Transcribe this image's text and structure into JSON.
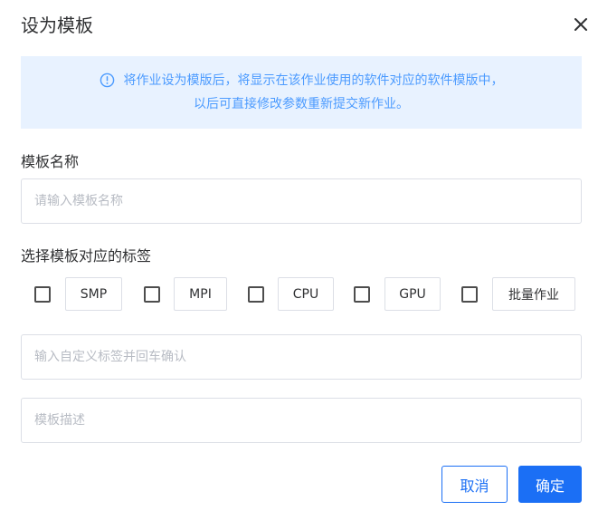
{
  "dialog": {
    "title": "设为模板",
    "close_icon": "close-icon",
    "notice": {
      "icon": "info-circle-icon",
      "line1": "将作业设为模版后，将显示在该作业使用的软件对应的软件模版中，",
      "line2": "以后可直接修改参数重新提交新作业。",
      "color": "#4c9bff",
      "background": "#e8f2ff"
    },
    "name_field": {
      "label": "模板名称",
      "placeholder": "请输入模板名称",
      "value": ""
    },
    "tags_section": {
      "label": "选择模板对应的标签",
      "tags": [
        {
          "label": "SMP",
          "checked": false
        },
        {
          "label": "MPI",
          "checked": false
        },
        {
          "label": "CPU",
          "checked": false
        },
        {
          "label": "GPU",
          "checked": false
        },
        {
          "label": "批量作业",
          "checked": false
        }
      ],
      "custom_tag_placeholder": "输入自定义标签并回车确认"
    },
    "description_field": {
      "placeholder": "模板描述",
      "value": ""
    },
    "buttons": {
      "cancel": "取消",
      "confirm": "确定"
    },
    "accent_color": "#1b6ff5"
  }
}
